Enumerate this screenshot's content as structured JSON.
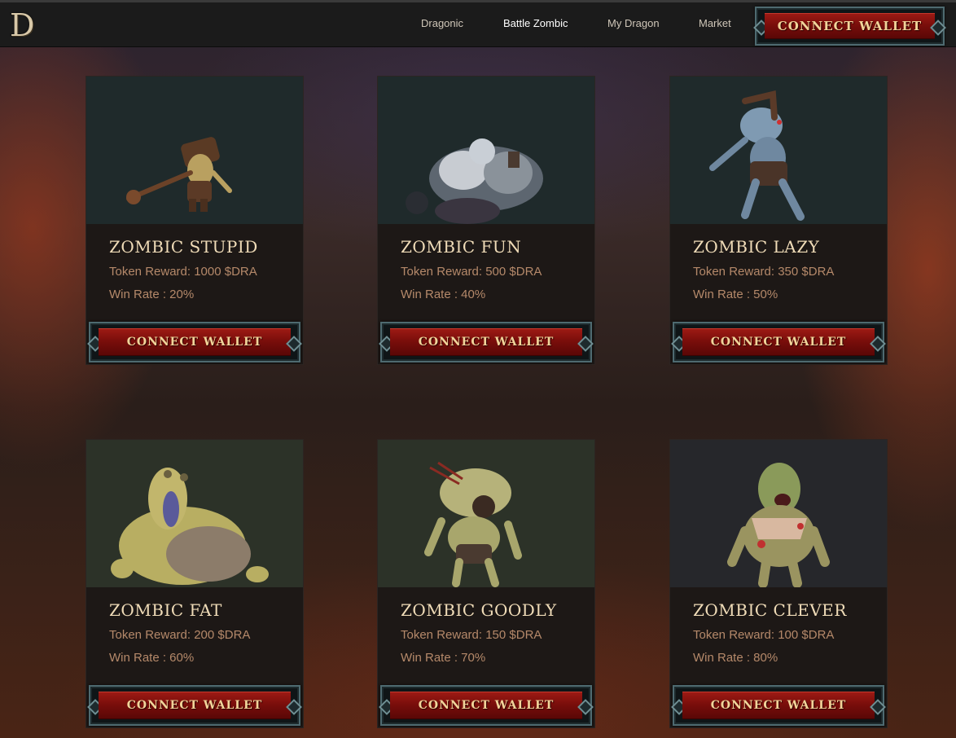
{
  "header": {
    "logo": "D",
    "nav": [
      {
        "label": "Dragonic"
      },
      {
        "label": "Battle Zombic"
      },
      {
        "label": "My Dragon"
      },
      {
        "label": "Market"
      }
    ],
    "connect_label": "CONNECT WALLET"
  },
  "cards": [
    {
      "name": "ZOMBIC STUPID",
      "reward": "Token Reward: 1000 $DRA",
      "rate": "Win Rate : 20%",
      "button": "CONNECT WALLET"
    },
    {
      "name": "ZOMBIC FUN",
      "reward": "Token Reward: 500 $DRA",
      "rate": "Win Rate : 40%",
      "button": "CONNECT WALLET"
    },
    {
      "name": "ZOMBIC LAZY",
      "reward": "Token Reward: 350 $DRA",
      "rate": "Win Rate : 50%",
      "button": "CONNECT WALLET"
    },
    {
      "name": "ZOMBIC FAT",
      "reward": "Token Reward: 200 $DRA",
      "rate": "Win Rate : 60%",
      "button": "CONNECT WALLET"
    },
    {
      "name": "ZOMBIC GOODLY",
      "reward": "Token Reward: 150 $DRA",
      "rate": "Win Rate : 70%",
      "button": "CONNECT WALLET"
    },
    {
      "name": "ZOMBIC CLEVER",
      "reward": "Token Reward: 100 $DRA",
      "rate": "Win Rate : 80%",
      "button": "CONNECT WALLET"
    }
  ],
  "colors": {
    "button_red": "#8a1410",
    "button_text": "#f1d49a",
    "name_text": "#f0dcb8",
    "stat_text": "#b5896a",
    "card_bg": "#1d1816"
  }
}
